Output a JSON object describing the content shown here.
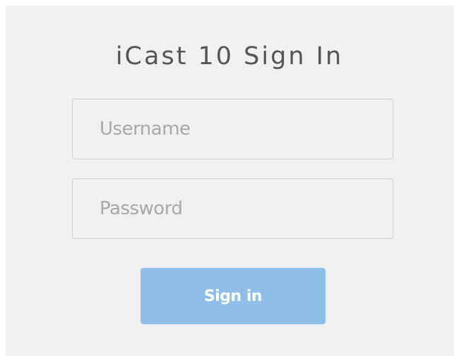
{
  "login": {
    "title": "iCast 10 Sign In",
    "username": {
      "value": "",
      "placeholder": "Username"
    },
    "password": {
      "value": "",
      "placeholder": "Password"
    },
    "submit_label": "Sign in"
  },
  "colors": {
    "panel_background": "#f0f0f0",
    "field_border": "#cfcfcf",
    "placeholder_text": "#a6a9ac",
    "title_text": "#555555",
    "button_background": "#8fbfe9",
    "button_text": "#ffffff"
  }
}
